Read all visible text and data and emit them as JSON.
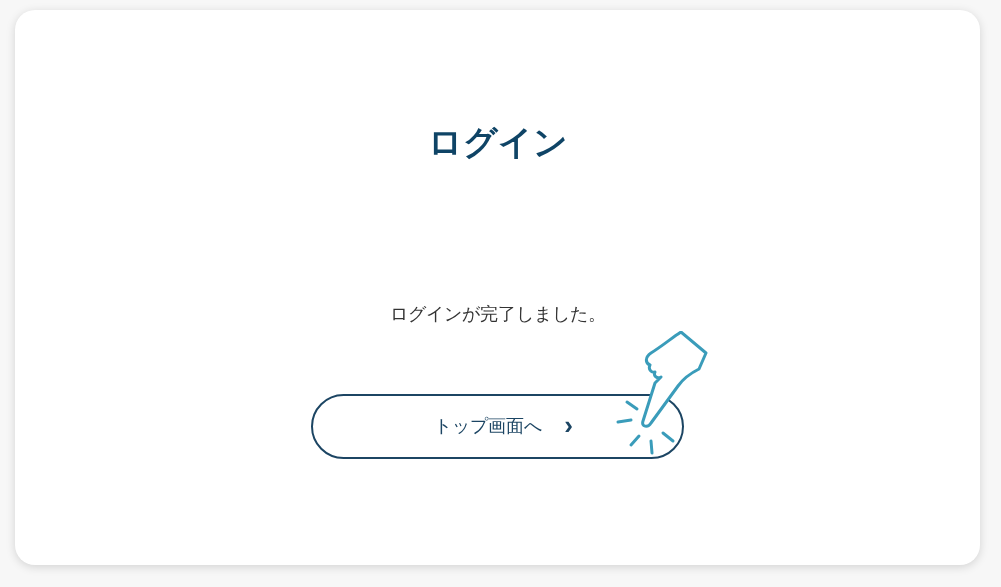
{
  "title": "ログイン",
  "message": "ログインが完了しました。",
  "button": {
    "label": "トップ画面へ",
    "icon": "›"
  }
}
